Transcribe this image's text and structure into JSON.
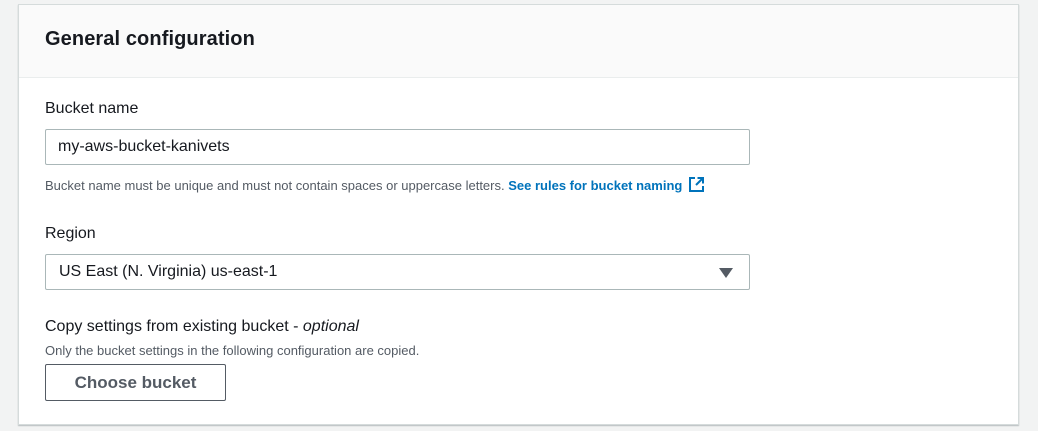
{
  "panel": {
    "title": "General configuration"
  },
  "bucket_name": {
    "label": "Bucket name",
    "value": "my-aws-bucket-kanivets",
    "hint": "Bucket name must be unique and must not contain spaces or uppercase letters.",
    "hint_link": "See rules for bucket naming",
    "hint_link_icon": "external-link-icon"
  },
  "region": {
    "label": "Region",
    "selected": "US East (N. Virginia) us-east-1",
    "caret_icon": "caret-down-icon"
  },
  "copy_settings": {
    "label": "Copy settings from existing bucket - ",
    "label_optional": "optional",
    "description": "Only the bucket settings in the following configuration are copied.",
    "button_label": "Choose bucket"
  },
  "colors": {
    "link": "#0073bb",
    "panel_header_bg": "#fafafa",
    "page_bg": "#f2f3f3",
    "input_border": "#aab7b8"
  }
}
